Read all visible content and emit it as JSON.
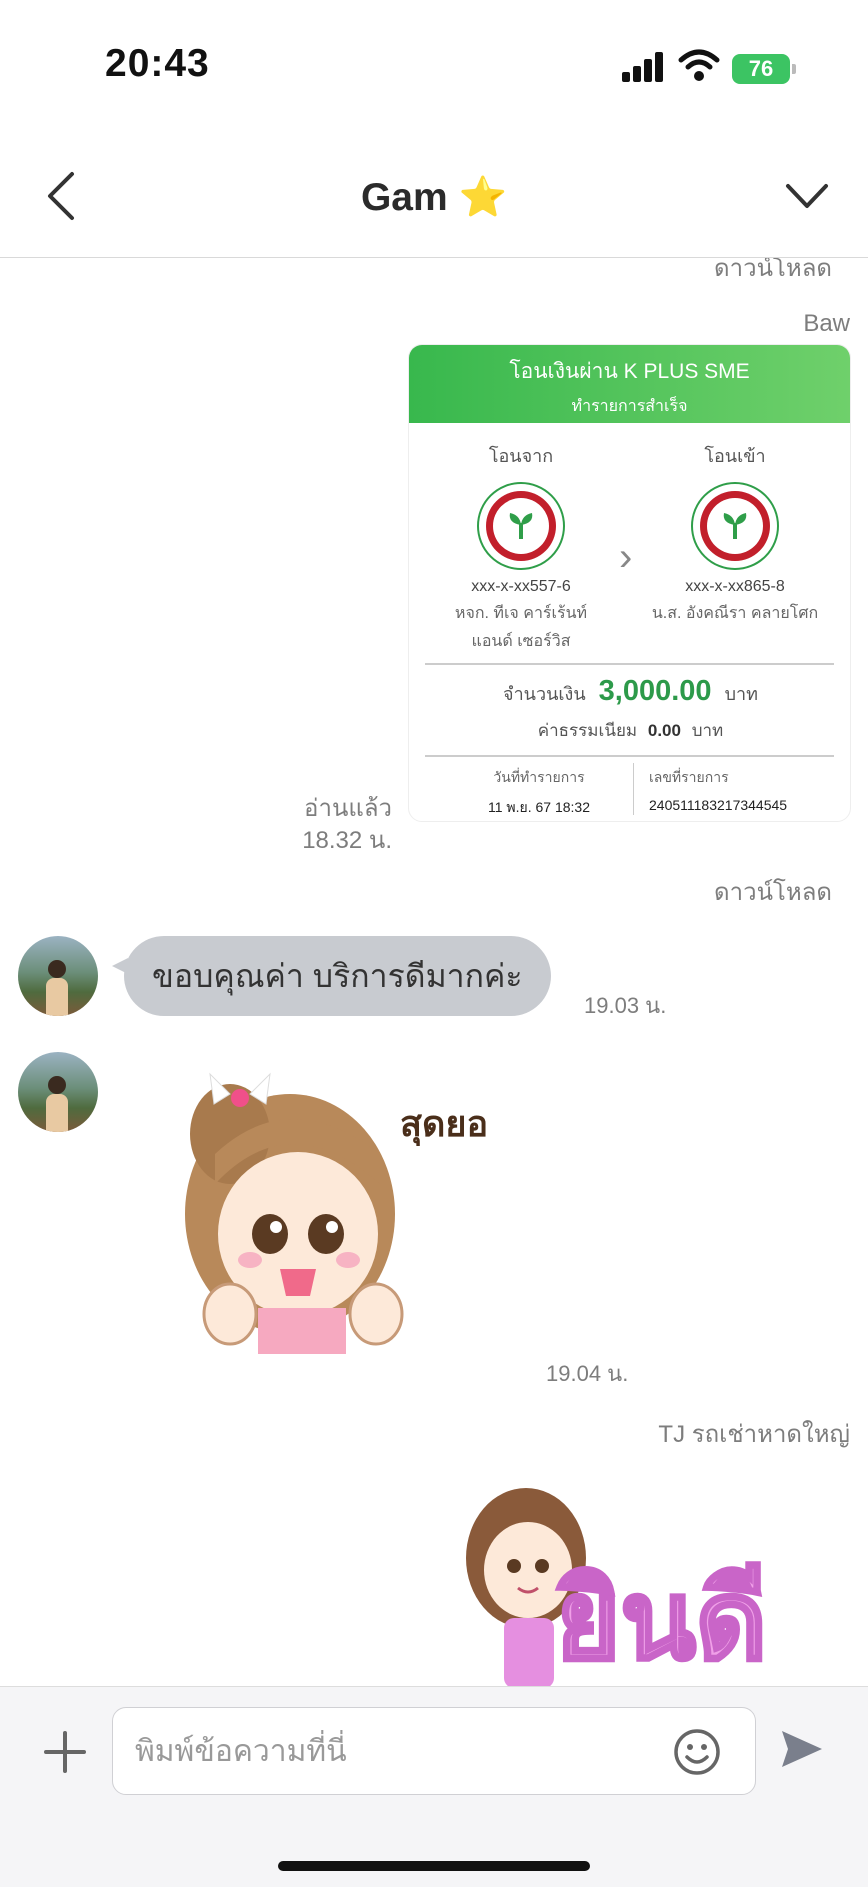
{
  "status_bar": {
    "time": "20:43",
    "battery": "76"
  },
  "header": {
    "title": "Gam ⭐"
  },
  "messages": {
    "download_top": "ดาวน์โหลด",
    "sender_baw": "Baw",
    "receipt": {
      "title": "โอนเงินผ่าน K PLUS SME",
      "subtitle": "ทำรายการสำเร็จ",
      "from_label": "โอนจาก",
      "to_label": "โอนเข้า",
      "from_account": "xxx-x-xx557-6",
      "from_name_1": "หจก. ทีเจ คาร์เร้นท์",
      "from_name_2": "แอนด์ เซอร์วิส",
      "to_account": "xxx-x-xx865-8",
      "to_name": "น.ส. อังคณีรา คลายโศก",
      "amount_label": "จำนวนเงิน",
      "amount": "3,000.00",
      "currency": "บาท",
      "fee_label": "ค่าธรรมเนียม",
      "fee": "0.00",
      "date_label": "วันที่ทำรายการ",
      "date_value": "11 พ.ย. 67 18:32",
      "ref_label": "เลขที่รายการ",
      "ref_value": "240511183217344545"
    },
    "read_label": "อ่านแล้ว",
    "read_time": "18.32 น.",
    "download_label": "ดาวน์โหลด",
    "incoming_text": "ขอบคุณค่า บริการดีมากค่ะ",
    "incoming_time": "19.03 น.",
    "sticker_text": "สุดยอด",
    "sticker_time": "19.04 น.",
    "sender_tj": "TJ รถเช่าหาดใหญ่",
    "sticker2_text": "ยินดี"
  },
  "input": {
    "placeholder": "พิมพ์ข้อความที่นี่"
  }
}
